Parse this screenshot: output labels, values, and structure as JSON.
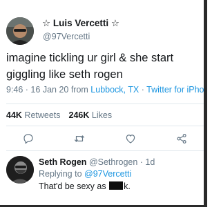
{
  "tweet": {
    "display_name": "☆ Luis Vercetti ☆",
    "handle": "@97Vercetti",
    "text": "imagine tickling ur girl & she start giggling like seth rogen",
    "time": "9:46 · 16 Jan 20 from ",
    "location": "Lubbock, TX",
    "separator": " · ",
    "client": "Twitter for iPhone",
    "retweets_count": "44K",
    "retweets_label": "Retweets",
    "likes_count": "246K",
    "likes_label": "Likes"
  },
  "actions": {
    "icons": [
      "reply-icon",
      "retweet-icon",
      "like-icon",
      "share-icon"
    ]
  },
  "reply": {
    "name": "Seth Rogen",
    "handle": "@Sethrogen",
    "time": " · 1d",
    "replying_prefix": "Replying to ",
    "replying_to": "@97Vercetti",
    "text_before": "That'd be sexy as ",
    "text_after": "k."
  },
  "colors": {
    "link": "#1b95e0",
    "muted": "#657786",
    "text": "#14171a",
    "divider": "#e1e8ed"
  }
}
